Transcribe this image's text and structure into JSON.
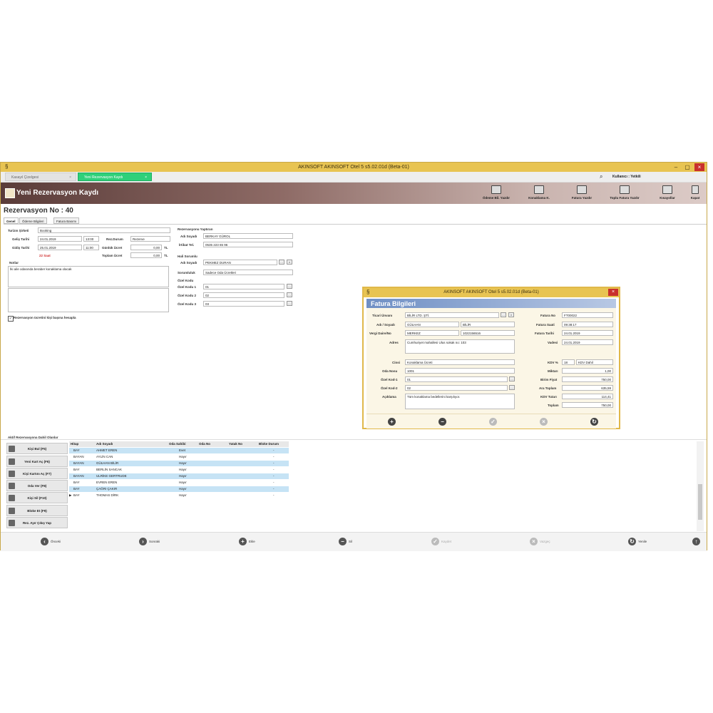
{
  "app": {
    "title": "AKINSOFT AKINSOFT Otel 5 s5.02.01d (Beta-01)",
    "tabs": [
      {
        "label": "Kasayıl Çizelgesi"
      },
      {
        "label": "Yeni Rezervasyon Kaydı"
      }
    ],
    "user": "Kullanıcı : Yetkili"
  },
  "header": {
    "title": "Yeni Rezervasyon Kaydı",
    "tools": [
      "Ödeme Bil. Yazdır",
      "Konaklama K.",
      "Fatura Yazdır",
      "Toplu Fatura Yazdır",
      "Kısayollar",
      "Kapat"
    ]
  },
  "form": {
    "rez_no": "Rezervasyon No : 40",
    "subtabs": [
      "Genel",
      "Ödeme Bilgileri",
      "Fatura Basımı"
    ],
    "turizm_label": "Turizm Şirketi",
    "turizm_value": "Booking",
    "gelis_label": "Geliş Tarihi",
    "gelis_date": "24.01.2019",
    "gelis_time": "13:00",
    "cikis_label": "Gidiş Tarihi",
    "cikis_date": "25.01.2019",
    "cikis_time": "11:00",
    "gece": "22 Saat",
    "rezdurum_label": "Rez.Durum",
    "rezdurum_value": "Rezerve",
    "gunluk_label": "Günlük Ücret",
    "gunluk_value": "0,00",
    "toplam_label": "Toplam Ücret",
    "toplam_value": "0,00",
    "currency": "TL",
    "notlar_label": "Notlar",
    "notlar_value": "İki aile odasında beraber konaklama olacak",
    "checkbox_label": "Rezervasyon ücretini kişi başına hesapla",
    "yaptiran_title": "Rezervasyonu Yaptıran",
    "adsoyad_label": "Adı Soyadı",
    "adsoyad_value": "BERKAY GÜROL",
    "irtibat_label": "İrtibat Tel.",
    "irtibat_value": "0535 223 65 96",
    "hali_title": "Hali Sorumlu",
    "hali_adsoyad_label": "Adı Soyadı",
    "hali_adsoyad_value": "PEKMEZ DURAN",
    "sorumluluk_label": "Sorumluluk",
    "sorumluluk_value": "Sadece Oda Ücretleri",
    "ozelkodu_title": "Özel Kodu",
    "ozel1_label": "Özel Kodu 1",
    "ozel1_value": "01",
    "ozel2_label": "Özel Kodu 2",
    "ozel2_value": "02",
    "ozel3_label": "Özel Kodu 3",
    "ozel3_value": "03"
  },
  "modal": {
    "title": "AKINSOFT AKINSOFT Otel 5 s5.02.01d (Beta-01)",
    "header": "Fatura Bilgileri",
    "ticari_label": "Ticari Ünvanı",
    "ticari_value": "BİLİR LTD. ŞTİ.",
    "adsoyad_label": "Adı / Soyadı",
    "ad_value": "GÜLHAN",
    "soyad_value": "BİLİR",
    "vergi_label": "Vergi Daire/No",
    "vergi_daire": "MERKEZ",
    "vergi_no": "1022156516",
    "adres_label": "Adres",
    "adres_value": "Cumhuriyet mahallesi Ulus sokak no: 103",
    "cinsi_label": "Cinsi",
    "cinsi_value": "Konaklama Ücreti",
    "odano_label": "Oda Nosu",
    "odano_value": "1001",
    "ozel1_label": "Özel Kod-1",
    "ozel1_value": "01",
    "ozel2_label": "Özel Kod-2",
    "ozel2_value": "02",
    "aciklama_label": "Açıklama",
    "aciklama_value": "Tüm konaklama bedellerini karşılıyor.",
    "faturano_label": "Fatura No",
    "faturano_value": "FT00022",
    "saati_label": "Fatura Saati",
    "saati_value": "09:38:17",
    "tarihi_label": "Fatura Tarihi",
    "tarihi_value": "24.01.2019",
    "vadesi_label": "Vadesi",
    "vadesi_value": "24.01.2019",
    "kdvp_label": "KDV %",
    "kdvp_value": "18",
    "kdv_type": "KDV Dahil",
    "miktar_label": "Miktarı",
    "miktar_value": "1,00",
    "birim_label": "Birim Fiyat",
    "birim_value": "750,00",
    "ara_label": "Ara Toplam",
    "ara_value": "635,59",
    "kdvt_label": "KDV Tutarı",
    "kdvt_value": "114,41",
    "toplam_label": "Toplam",
    "toplam_value": "750,00"
  },
  "active": {
    "title": "Aktif Rezervasyona Dahil Olanlar",
    "buttons": [
      "Kişi Bul (F5)",
      "Yeni Kart Aç (F6)",
      "Kişi Kartını Aç (F7)",
      "Oda Ver (F8)",
      "Kişi Sil (F10)",
      "Bloke Et (F9)",
      "Rez. Ayır Çıkış Yap"
    ],
    "columns": [
      "Hitap",
      "Adı Soyadı",
      "Oda Sahibi",
      "Oda No",
      "Yatak No",
      "Bloke Durum"
    ],
    "rows": [
      [
        "BAY",
        "AHMET EREN",
        "Evet",
        "",
        "",
        "-"
      ],
      [
        "BAYAN",
        "AYLİN CAN",
        "Hayır",
        "",
        "",
        "-"
      ],
      [
        "BAYAN",
        "GÜLHAN BİLİR",
        "Hayır",
        "",
        "",
        "-"
      ],
      [
        "BAY",
        "BERLİN SANCAK",
        "Hayır",
        "",
        "",
        "-"
      ],
      [
        "BAYAN",
        "ULRİKE GERTRUDE",
        "Hayır",
        "",
        "",
        "-"
      ],
      [
        "BAY",
        "EVREN EREN",
        "Hayır",
        "",
        "",
        "-"
      ],
      [
        "BAY",
        "ÇAĞRI ÇAKIR",
        "Hayır",
        "",
        "",
        "-"
      ],
      [
        "BAY",
        "THOMAS DİRK",
        "Hayır",
        "",
        "",
        "-"
      ]
    ]
  },
  "footer": {
    "prev": "Önceki",
    "next": "Sonraki",
    "add": "Ekle",
    "del": "Sil",
    "save": "Kaydet",
    "cancel": "Vazgeç",
    "refresh": "Yenile"
  },
  "colors": {
    "accent_title": "#e8c452",
    "tab_active": "#2fd07a",
    "header_brown": "#5a3c39",
    "modal_blue": "#6f8fc4"
  }
}
